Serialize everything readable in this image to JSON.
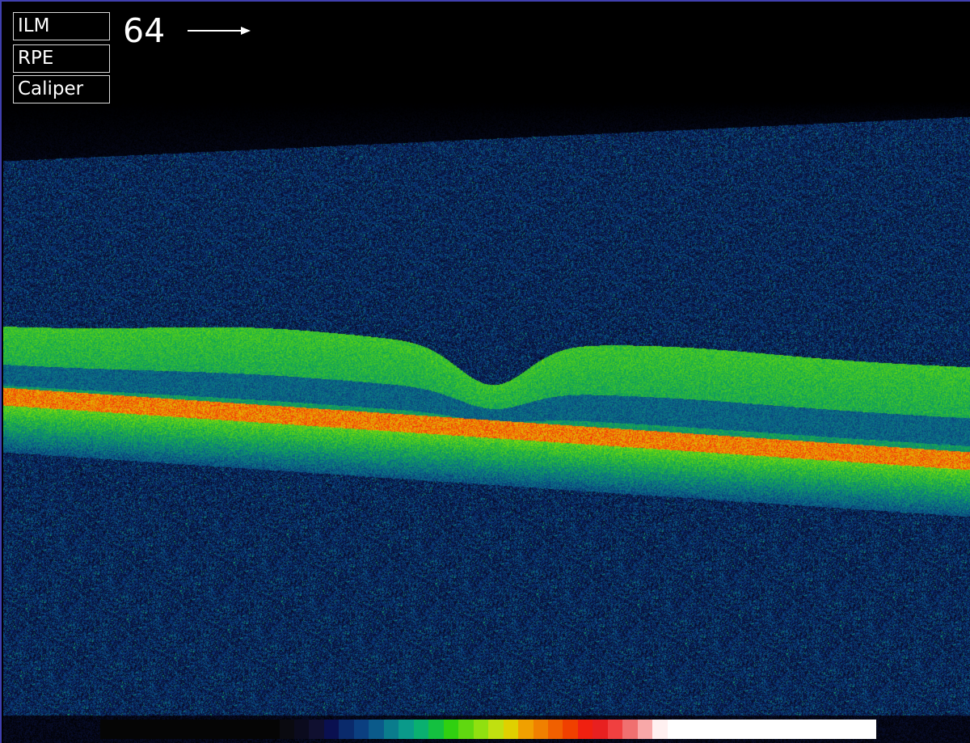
{
  "toolbar": {
    "ilm_label": "ILM",
    "rpe_label": "RPE",
    "caliper_label": "Caliper"
  },
  "frame_number": "64",
  "frame_arrow_icon": "right-arrow-icon",
  "scan": {
    "description_colormap": "rainbow-intensity",
    "background_color": "#000000"
  },
  "colorbar": {
    "colors": [
      "#050505",
      "#0a0a10",
      "#0b0b1e",
      "#101030",
      "#0a1050",
      "#0a2a6b",
      "#0b3f80",
      "#0b5a8a",
      "#0a7c8c",
      "#0a9a8a",
      "#0ab070",
      "#14c040",
      "#30d010",
      "#60d810",
      "#90e010",
      "#c0e010",
      "#e0d000",
      "#f0a000",
      "#f08000",
      "#f06000",
      "#f04000",
      "#f02010",
      "#e82020",
      "#f04040",
      "#f07070",
      "#f8a8a8",
      "#fff0f0",
      "#ffffff"
    ]
  }
}
